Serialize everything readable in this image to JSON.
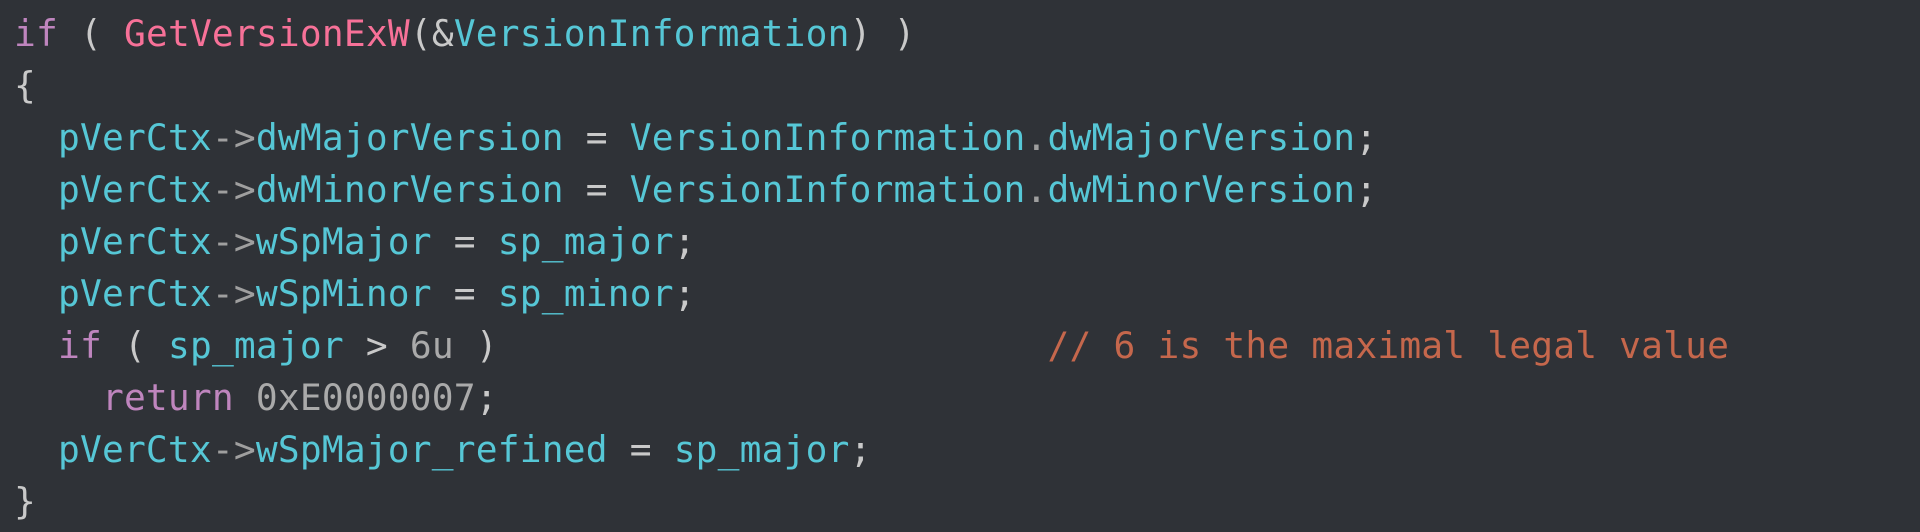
{
  "code": {
    "if_kw": "if",
    "return_kw": "return",
    "func_call": "GetVersionExW",
    "amp": "&",
    "ver_info": "VersionInformation",
    "pVerCtx": "pVerCtx",
    "arrow": "->",
    "dot": ".",
    "eq": "=",
    "gt": ">",
    "semi": ";",
    "lbrace": "{",
    "rbrace": "}",
    "lparen": "(",
    "rparen": ")",
    "dwMajorVersion": "dwMajorVersion",
    "dwMinorVersion": "dwMinorVersion",
    "wSpMajor": "wSpMajor",
    "wSpMinor": "wSpMinor",
    "wSpMajor_refined": "wSpMajor_refined",
    "sp_major": "sp_major",
    "sp_minor": "sp_minor",
    "six_u": "6u",
    "ret_hex": "0xE0000007",
    "comment_spmax": "// 6 is the maximal legal value"
  }
}
